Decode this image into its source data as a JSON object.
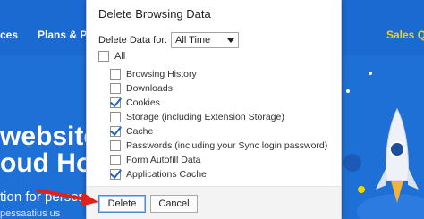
{
  "background_page": {
    "nav": [
      "ces",
      "Plans & Pri",
      "Sales Qu"
    ],
    "hero_line1": "website",
    "hero_line2": "oud Host",
    "hero_sub": "tion for person",
    "hero_sub2": "pessaatius us"
  },
  "dialog": {
    "title": "Delete Browsing Data",
    "range_label": "Delete Data for:",
    "range_value": "All Time",
    "all_label": "All",
    "all_checked": false,
    "items": [
      {
        "label": "Browsing History",
        "checked": false
      },
      {
        "label": "Downloads",
        "checked": false
      },
      {
        "label": "Cookies",
        "checked": true
      },
      {
        "label": "Storage (including Extension Storage)",
        "checked": false
      },
      {
        "label": "Cache",
        "checked": true
      },
      {
        "label": "Passwords (including your Sync login password)",
        "checked": false
      },
      {
        "label": "Form Autofill Data",
        "checked": false
      },
      {
        "label": "Applications Cache",
        "checked": true
      }
    ],
    "delete_label": "Delete",
    "cancel_label": "Cancel"
  },
  "colors": {
    "page_blue": "#1e6fd6",
    "accent_yellow": "#f7d200",
    "check_blue": "#1f62c8",
    "arrow_red": "#e0211b"
  }
}
